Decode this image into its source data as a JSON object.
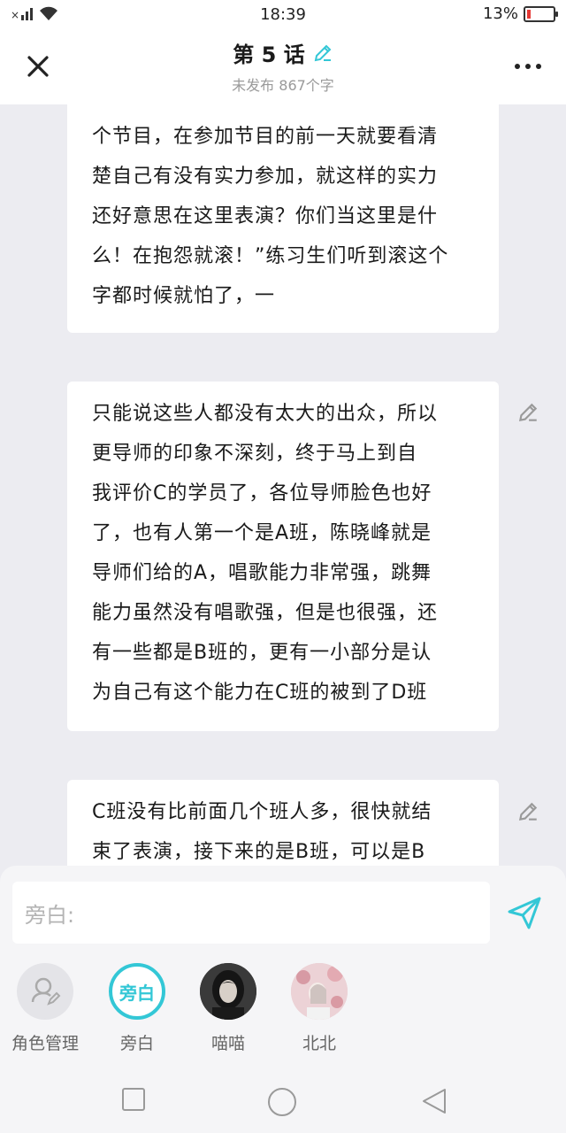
{
  "status_bar": {
    "time": "18:39",
    "battery_text": "13%",
    "battery_level": 0.13,
    "signal_text": "×ıll",
    "wifi_icon": "wifi-icon"
  },
  "header": {
    "title": "第 5 话",
    "subtitle": "未发布 867个字",
    "edit_icon": "pencil-icon",
    "close_icon": "close-icon",
    "more_icon": "more-icon"
  },
  "paragraphs": [
    {
      "text": "个节目，在参加节目的前一天就要看清\n楚自己有没有实力参加，就这样的实力\n还好意思在这里表演？你们当这里是什\n么！在抱怨就滚！”练习生们听到滚这个\n字都时候就怕了，一"
    },
    {
      "text": "只能说这些人都没有太大的出众，所以\n更导师的印象不深刻，终于马上到自\n我评价C的学员了，各位导师脸色也好\n了，也有人第一个是A班，陈晓峰就是\n导师们给的A，唱歌能力非常强，跳舞\n能力虽然没有唱歌强，但是也很强，还\n有一些都是B班的，更有一小部分是认\n为自己有这个能力在C班的被到了D班"
    },
    {
      "text": "C班没有比前面几个班人多，很快就结\n束了表演，接下来的是B班，可以是B"
    }
  ],
  "composer": {
    "placeholder": "旁白:",
    "send_icon": "send-icon"
  },
  "roles": [
    {
      "label": "角色管理",
      "icon": "role-manage-icon"
    },
    {
      "label": "旁白",
      "avatar_text": "旁白",
      "selected": true
    },
    {
      "label": "喵喵",
      "icon": "avatar-photo"
    },
    {
      "label": "北北",
      "icon": "avatar-photo"
    }
  ],
  "nav": {
    "recent_icon": "square-icon",
    "home_icon": "circle-icon",
    "back_icon": "triangle-back-icon"
  },
  "colors": {
    "accent": "#33c7d6",
    "background": "#ececf1",
    "card": "#ffffff",
    "battery_low": "#e53935"
  }
}
